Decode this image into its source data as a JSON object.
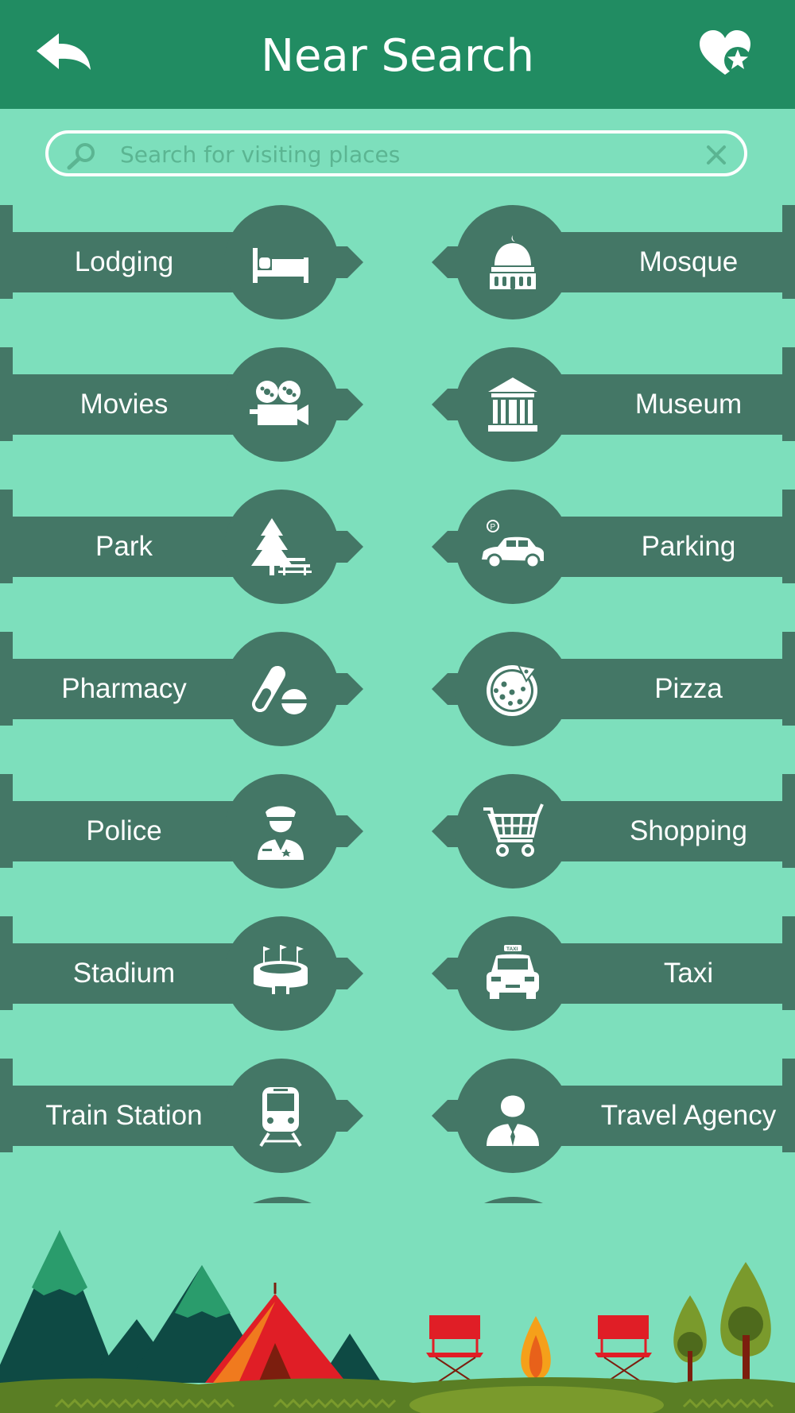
{
  "header": {
    "title": "Near Search"
  },
  "search": {
    "placeholder": "Search for visiting places",
    "value": ""
  },
  "icons": {
    "back": "back-arrow-icon",
    "favorites": "heart-star-icon",
    "search": "magnifier-icon",
    "clear": "close-icon"
  },
  "colors": {
    "header": "#218c62",
    "background": "#7ddfbc",
    "item": "#447766",
    "text": "#ffffff"
  },
  "categories": [
    {
      "label": "Lodging",
      "icon": "bed-icon"
    },
    {
      "label": "Mosque",
      "icon": "mosque-icon"
    },
    {
      "label": "Movies",
      "icon": "movie-camera-icon"
    },
    {
      "label": "Museum",
      "icon": "museum-icon"
    },
    {
      "label": "Park",
      "icon": "tree-bench-icon"
    },
    {
      "label": "Parking",
      "icon": "car-parking-icon"
    },
    {
      "label": "Pharmacy",
      "icon": "pills-icon"
    },
    {
      "label": "Pizza",
      "icon": "pizza-icon"
    },
    {
      "label": "Police",
      "icon": "policeman-icon"
    },
    {
      "label": "Shopping",
      "icon": "shopping-cart-icon"
    },
    {
      "label": "Stadium",
      "icon": "stadium-icon"
    },
    {
      "label": "Taxi",
      "icon": "taxi-icon"
    },
    {
      "label": "Train Station",
      "icon": "train-icon"
    },
    {
      "label": "Travel Agency",
      "icon": "travel-agent-icon"
    }
  ]
}
